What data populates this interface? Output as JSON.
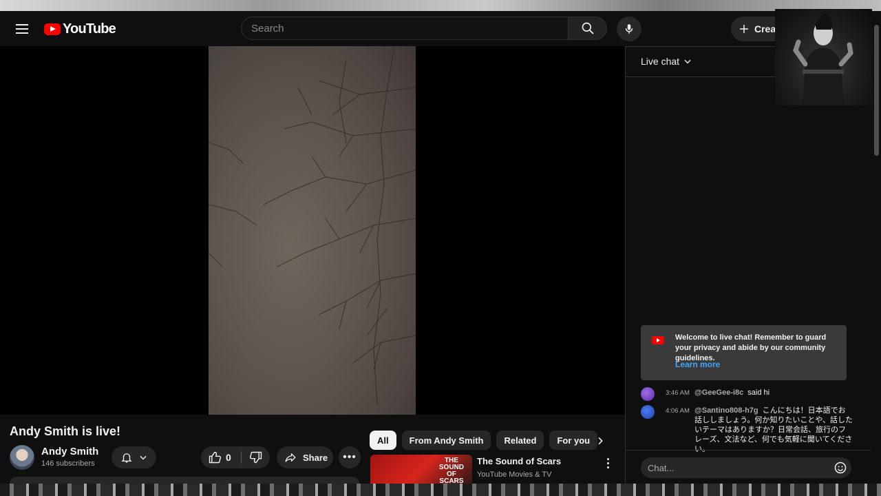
{
  "header": {
    "logo_text": "YouTube",
    "search_placeholder": "Search",
    "create_label": "Create"
  },
  "video": {
    "title": "Andy Smith is live!",
    "channel_name": "Andy Smith",
    "subscribers": "146 subscribers",
    "like_count": "0",
    "share_label": "Share"
  },
  "chips": [
    "All",
    "From Andy Smith",
    "Related",
    "For you"
  ],
  "related": {
    "title": "The Sound of Scars",
    "channel": "YouTube Movies & TV",
    "thumb_text_1": "THE",
    "thumb_text_2": "SOUND",
    "thumb_text_3": "OF",
    "thumb_text_4": "SCARS"
  },
  "chat": {
    "title": "Live chat",
    "welcome": "Welcome to live chat! Remember to guard your privacy and abide by our community guidelines.",
    "learn_more": "Learn more",
    "messages": [
      {
        "time": "3:46 AM",
        "author": "@GeeGee-i8c",
        "text": "said hi",
        "avatar_color": "#7a4fd6"
      },
      {
        "time": "4:06 AM",
        "author": "@Santino808-h7g",
        "text": "こんにちは！日本語でお話ししましょう。何か知りたいことや、話したいテーマはありますか？日常会話、旅行のフレーズ、文法など、何でも気軽に聞いてください。",
        "avatar_color": "#2f5bd8"
      }
    ],
    "input_placeholder": "Chat..."
  },
  "colors": {
    "accent_red": "#ff0000",
    "link_blue": "#3ea6ff",
    "background": "#0f0f0f"
  }
}
